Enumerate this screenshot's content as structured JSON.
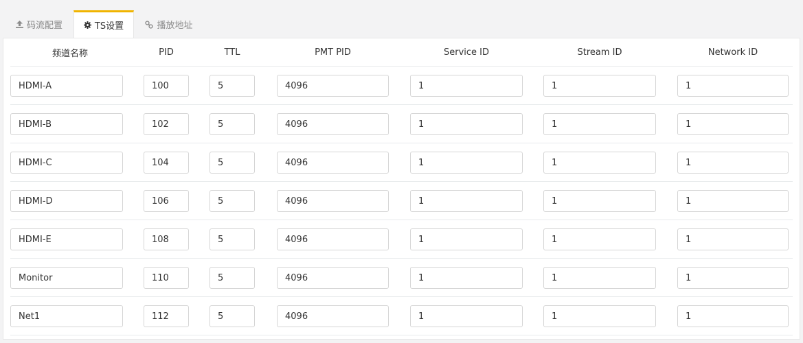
{
  "tabs": [
    {
      "label": "码流配置",
      "icon": "upload-icon"
    },
    {
      "label": "TS设置",
      "icon": "gear-icon"
    },
    {
      "label": "播放地址",
      "icon": "link-icon"
    }
  ],
  "active_tab": "TS设置",
  "accent_color": "#f0b400",
  "columns": [
    "频道名称",
    "PID",
    "TTL",
    "PMT PID",
    "Service ID",
    "Stream ID",
    "Network ID"
  ],
  "rows": [
    {
      "name": "HDMI-A",
      "pid": "100",
      "ttl": "5",
      "pmt_pid": "4096",
      "service_id": "1",
      "stream_id": "1",
      "network_id": "1"
    },
    {
      "name": "HDMI-B",
      "pid": "102",
      "ttl": "5",
      "pmt_pid": "4096",
      "service_id": "1",
      "stream_id": "1",
      "network_id": "1"
    },
    {
      "name": "HDMI-C",
      "pid": "104",
      "ttl": "5",
      "pmt_pid": "4096",
      "service_id": "1",
      "stream_id": "1",
      "network_id": "1"
    },
    {
      "name": "HDMI-D",
      "pid": "106",
      "ttl": "5",
      "pmt_pid": "4096",
      "service_id": "1",
      "stream_id": "1",
      "network_id": "1"
    },
    {
      "name": "HDMI-E",
      "pid": "108",
      "ttl": "5",
      "pmt_pid": "4096",
      "service_id": "1",
      "stream_id": "1",
      "network_id": "1"
    },
    {
      "name": "Monitor",
      "pid": "110",
      "ttl": "5",
      "pmt_pid": "4096",
      "service_id": "1",
      "stream_id": "1",
      "network_id": "1"
    },
    {
      "name": "Net1",
      "pid": "112",
      "ttl": "5",
      "pmt_pid": "4096",
      "service_id": "1",
      "stream_id": "1",
      "network_id": "1"
    }
  ]
}
